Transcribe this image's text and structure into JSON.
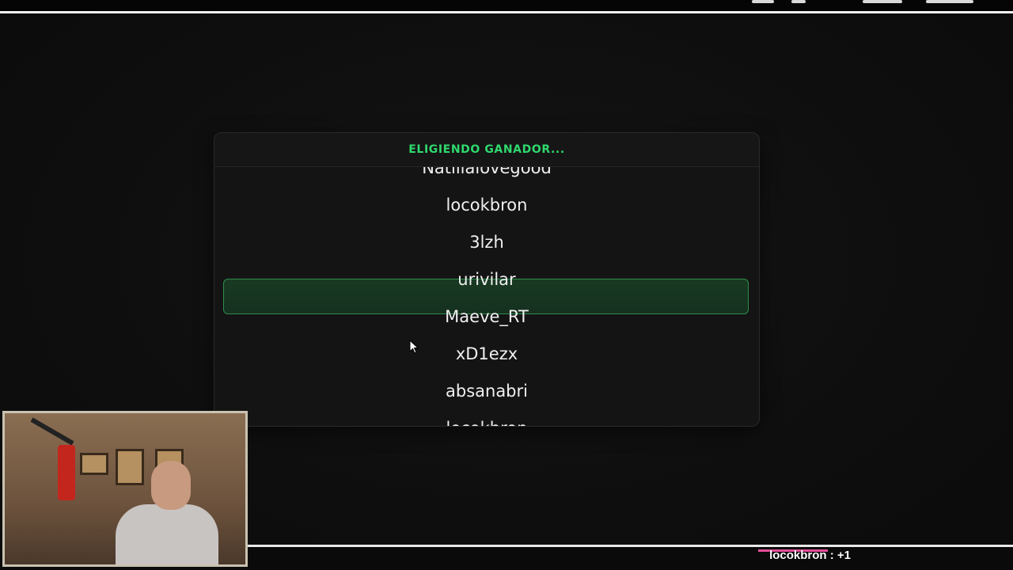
{
  "overlay": {
    "title": "ELIGIENDO GANADOR...",
    "names": [
      "Natilialovegood",
      "locokbron",
      "3lzh",
      "urivilar",
      "Maeve_RT",
      "xD1ezx",
      "absanabri",
      "locokbron"
    ],
    "selected_index": 4,
    "colors": {
      "title": "#2fd96e",
      "highlight_border": "#2d8d4c",
      "highlight_fill": "#183a22",
      "panel": "#141414"
    }
  },
  "webcam": {
    "icon": "webcam-feed"
  },
  "chat_alert": {
    "text": "locokbron : +1",
    "accent_color": "#e44d9a"
  },
  "cursor": {
    "icon": "mouse-pointer-icon"
  }
}
